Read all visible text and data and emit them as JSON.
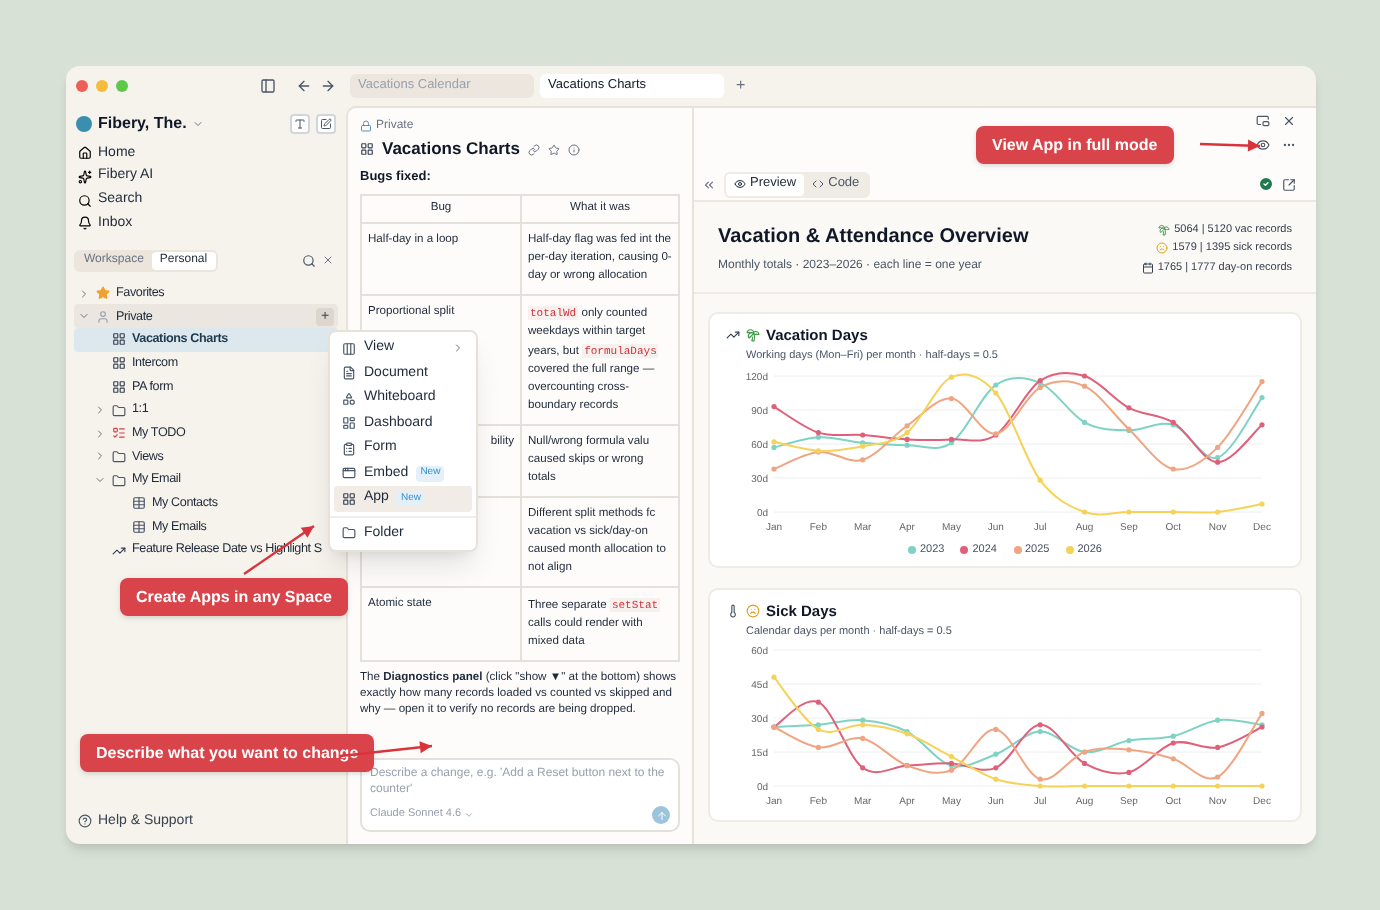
{
  "titlebar": {
    "tabs": [
      {
        "label": "Vacations Calendar",
        "selected": false
      },
      {
        "label": "Vacations Charts",
        "selected": true
      }
    ],
    "new_tab": "+"
  },
  "sidebar": {
    "workspace": "Fibery, The.",
    "nav": [
      {
        "kind": "home",
        "label": "Home"
      },
      {
        "kind": "ai",
        "label": "Fibery AI"
      },
      {
        "kind": "search",
        "label": "Search"
      },
      {
        "kind": "bell",
        "label": "Inbox"
      }
    ],
    "scope_tabs": [
      {
        "label": "Workspace",
        "selected": false
      },
      {
        "label": "Personal",
        "selected": true
      }
    ],
    "tree": [
      {
        "label": "Favorites",
        "kind": "star",
        "expanded": false,
        "selected": false
      },
      {
        "label": "Private",
        "kind": "person",
        "expanded": true,
        "selected": false,
        "action": "+",
        "children": [
          {
            "label": "Vacations Charts",
            "kind": "app",
            "selected": true
          },
          {
            "label": "Intercom",
            "kind": "app",
            "selected": false
          },
          {
            "label": "PA form",
            "kind": "app",
            "selected": false
          },
          {
            "label": "1:1",
            "kind": "folder",
            "expanded": false,
            "selected": false
          },
          {
            "label": "My TODO",
            "kind": "todo",
            "expanded": false,
            "selected": false
          },
          {
            "label": "Views",
            "kind": "folder",
            "expanded": false,
            "selected": false
          },
          {
            "label": "My Email",
            "kind": "folder",
            "expanded": true,
            "selected": false,
            "children": [
              {
                "label": "My Contacts",
                "kind": "table",
                "selected": false
              },
              {
                "label": "My Emails",
                "kind": "table",
                "selected": false
              }
            ]
          },
          {
            "label": "Feature Release Date vs Highlight S",
            "kind": "chart",
            "selected": false
          }
        ]
      }
    ],
    "footer": "Help & Support"
  },
  "menu": {
    "items": [
      {
        "label": "View",
        "kind": "view",
        "submenu": true,
        "selected": false
      },
      {
        "label": "Document",
        "kind": "doc",
        "selected": false
      },
      {
        "label": "Whiteboard",
        "kind": "board",
        "selected": false
      },
      {
        "label": "Dashboard",
        "kind": "dash",
        "selected": false
      },
      {
        "label": "Form",
        "kind": "form",
        "selected": false
      },
      {
        "label": "Embed",
        "kind": "embed",
        "badge": "New",
        "selected": false
      },
      {
        "label": "App",
        "kind": "app",
        "badge": "New",
        "selected": true
      },
      {
        "label": "Folder",
        "kind": "folder",
        "selected": false
      }
    ]
  },
  "document": {
    "breadcrumb": "Private",
    "title": "Vacations Charts",
    "heading": "Bugs fixed:",
    "table": {
      "columns": [
        "Bug",
        "What it was"
      ],
      "rows": [
        {
          "bug": "Half-day in a loop",
          "what": [
            {
              "kind": "text",
              "text": "Half-day flag was fed int the per-day iteration, causing 0-day or wrong allocation"
            }
          ]
        },
        {
          "bug": "Proportional split",
          "what": [
            {
              "kind": "code",
              "text": "totalWd"
            },
            {
              "kind": "text",
              "text": " only counted weekdays within target years, but "
            },
            {
              "kind": "code",
              "text": "formulaDays"
            },
            {
              "kind": "text",
              "text": " covered the full range — overcounting cross-boundary records"
            }
          ]
        },
        {
          "bug": "bility",
          "bug_cut_left": true,
          "what": [
            {
              "kind": "text",
              "text": "Null/wrong formula valu caused skips or wrong totals"
            }
          ]
        },
        {
          "what": [
            {
              "kind": "text",
              "text": "Different split methods fc vacation vs sick/day-on caused month allocation to not align"
            }
          ]
        },
        {
          "bug": "Atomic state",
          "what": [
            {
              "kind": "text",
              "text": "Three separate "
            },
            {
              "kind": "code",
              "text": "setStat"
            },
            {
              "kind": "text",
              "text": " calls could render with mixed data"
            }
          ]
        }
      ]
    },
    "note": "The **Diagnostics panel** (click \"show ▼\" at the bottom) shows exactly how many records loaded vs counted vs skipped and why — open it to verify no records are being dropped.",
    "composer": {
      "placeholder": "Describe a change, e.g. 'Add a Reset button next to the counter'",
      "model": "Claude Sonnet 4.6"
    }
  },
  "preview": {
    "tabs": [
      {
        "label": "Preview",
        "kind": "eye",
        "selected": true
      },
      {
        "label": "Code",
        "kind": "code",
        "selected": false
      }
    ],
    "app": {
      "title": "Vacation & Attendance Overview",
      "subtitle": "Monthly totals · 2023–2026 · each line = one year",
      "stats": [
        {
          "kind": "palm",
          "text": "5064 | 5120 vac records"
        },
        {
          "kind": "face",
          "text": "1579 | 1395 sick records"
        },
        {
          "kind": "calendar",
          "text": "1765 | 1777 day-on records"
        }
      ],
      "charts": [
        {
          "kind": "vacation",
          "title": "Vacation Days",
          "subtitle": "Working days (Mon–Fri) per month · half-days = 0.5",
          "chart_data": {
            "type": "line",
            "grid": true,
            "categories": [
              "Jan",
              "Feb",
              "Mar",
              "Apr",
              "May",
              "Jun",
              "Jul",
              "Aug",
              "Sep",
              "Oct",
              "Nov",
              "Dec"
            ],
            "ylim": [
              0,
              120
            ],
            "yticks": [
              {
                "value": 0,
                "label": "0d"
              },
              {
                "value": 30,
                "label": "30d"
              },
              {
                "value": 60,
                "label": "60d"
              },
              {
                "value": 90,
                "label": "90d"
              },
              {
                "value": 120,
                "label": "120d"
              }
            ],
            "series": [
              {
                "name": "2023",
                "color": "#7fd3c4",
                "values": [
                  57,
                  66,
                  61,
                  59,
                  61,
                  112,
                  114,
                  79,
                  72,
                  77,
                  48,
                  101
                ]
              },
              {
                "name": "2024",
                "color": "#e0607a",
                "values": [
                  93,
                  70,
                  68,
                  64,
                  64,
                  68,
                  116,
                  120,
                  92,
                  79,
                  44,
                  77
                ]
              },
              {
                "name": "2025",
                "color": "#f0a582",
                "values": [
                  38,
                  53,
                  46,
                  76,
                  100,
                  69,
                  110,
                  111,
                  73,
                  38,
                  57,
                  115
                ]
              },
              {
                "name": "2026",
                "color": "#f5d35a",
                "values": [
                  62,
                  54,
                  58,
                  70,
                  119,
                  105,
                  28,
                  0,
                  0,
                  0,
                  0,
                  7
                ]
              }
            ]
          }
        },
        {
          "kind": "sick",
          "title": "Sick Days",
          "subtitle": "Calendar days per month · half-days = 0.5",
          "chart_data": {
            "type": "line",
            "grid": true,
            "categories": [
              "Jan",
              "Feb",
              "Mar",
              "Apr",
              "May",
              "Jun",
              "Jul",
              "Aug",
              "Sep",
              "Oct",
              "Nov",
              "Dec"
            ],
            "ylim": [
              0,
              60
            ],
            "yticks": [
              {
                "value": 0,
                "label": "0d"
              },
              {
                "value": 15,
                "label": "15d"
              },
              {
                "value": 30,
                "label": "30d"
              },
              {
                "value": 45,
                "label": "45d"
              },
              {
                "value": 60,
                "label": "60d"
              }
            ],
            "series": [
              {
                "color": "#7fd3c4",
                "values": [
                  26,
                  27,
                  29,
                  24,
                  9,
                  14,
                  24,
                  15,
                  20,
                  22,
                  29,
                  27
                ]
              },
              {
                "color": "#e0607a",
                "values": [
                  26,
                  37,
                  8,
                  9,
                  10,
                  8,
                  27,
                  10,
                  6,
                  19,
                  17,
                  26
                ]
              },
              {
                "color": "#f0a582",
                "values": [
                  26,
                  17,
                  21,
                  9,
                  7,
                  25,
                  3,
                  15,
                  16,
                  12,
                  4,
                  32
                ]
              },
              {
                "color": "#f5d35a",
                "values": [
                  48,
                  25,
                  27,
                  23,
                  13,
                  3,
                  0,
                  0,
                  0,
                  0,
                  0,
                  0
                ]
              }
            ]
          }
        }
      ]
    }
  },
  "annotations": [
    {
      "text": "View App in full mode"
    },
    {
      "text": "Create Apps in any Space"
    },
    {
      "text": "Describe what you want to change"
    }
  ]
}
